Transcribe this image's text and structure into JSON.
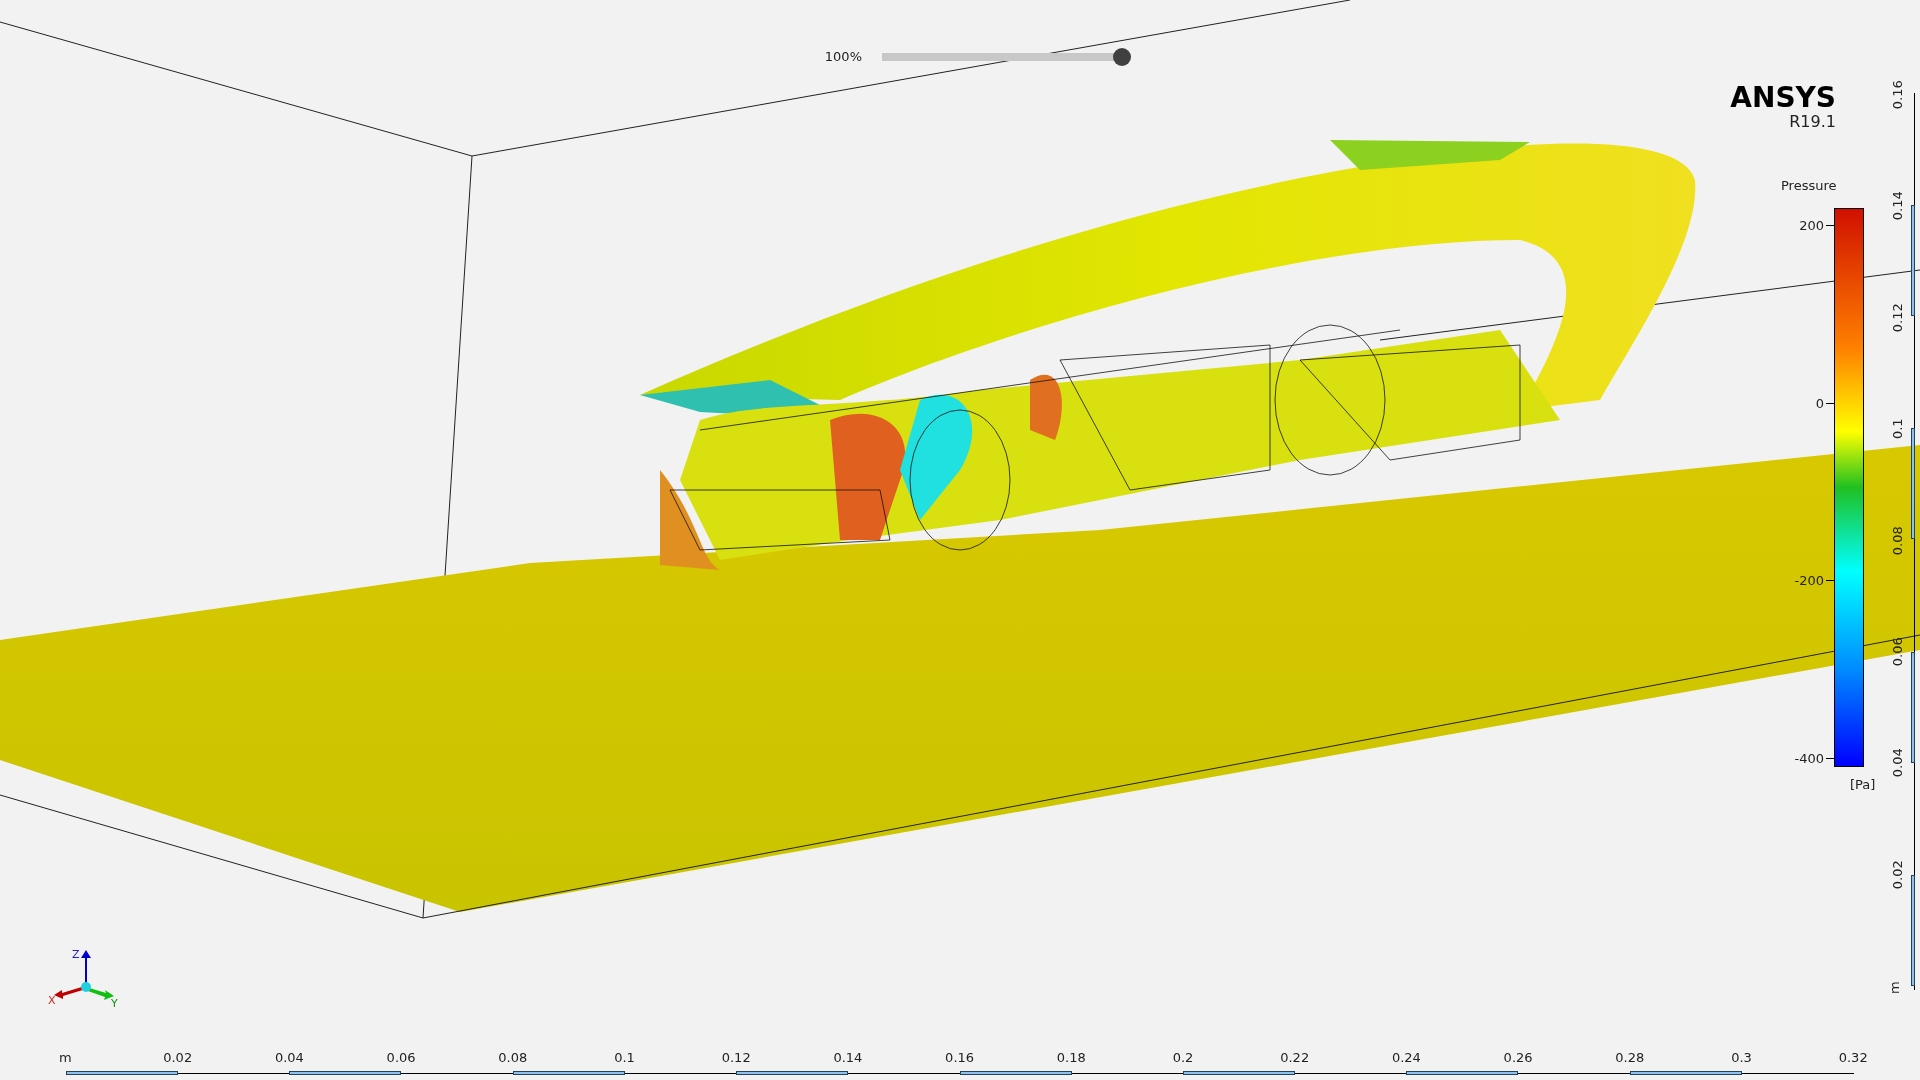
{
  "zoom_slider": {
    "label": "100%",
    "level": 1
  },
  "logo": {
    "brand": "ANSYS",
    "version": "R19.1"
  },
  "legend": {
    "title": "Pressure",
    "ticks": [
      "200",
      "0",
      "-200",
      "-400"
    ],
    "unit": "[Pa]"
  },
  "vertical_ruler": {
    "labels": [
      "0.16",
      "0.14",
      "0.12",
      "0.1",
      "0.08",
      "0.06",
      "0.04",
      "0.02"
    ],
    "unit": "m"
  },
  "horizontal_ruler": {
    "unit": "m",
    "labels": [
      "0.02",
      "0.04",
      "0.06",
      "0.08",
      "0.1",
      "0.12",
      "0.14",
      "0.16",
      "0.18",
      "0.2",
      "0.22",
      "0.24",
      "0.26",
      "0.28",
      "0.3",
      "0.32"
    ]
  },
  "axis_triad": {
    "x": "X",
    "y": "Y",
    "z": "Z"
  }
}
